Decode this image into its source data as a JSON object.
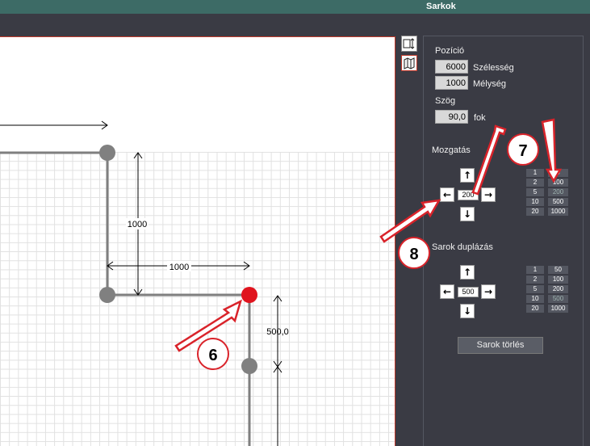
{
  "window": {
    "title": "Sarkok"
  },
  "canvas": {
    "dim_vertical": "1000",
    "dim_horizontal": "1000",
    "dim_side": "500,0"
  },
  "side_icons": [
    "resize-icon",
    "map-icon"
  ],
  "position": {
    "heading": "Pozíció",
    "width_value": "6000",
    "width_label": "Szélesség",
    "depth_value": "1000",
    "depth_label": "Mélység"
  },
  "angle": {
    "heading": "Szög",
    "value": "90,0",
    "unit": "fok"
  },
  "move": {
    "heading": "Mozgatás",
    "step_value": "200",
    "steps_left": [
      "1",
      "2",
      "5",
      "10",
      "20"
    ],
    "steps_right": [
      "0",
      "100",
      "200",
      "500",
      "1000"
    ],
    "selected_right": "200"
  },
  "duplicate": {
    "heading": "Sarok duplázás",
    "step_value": "500",
    "steps_left": [
      "1",
      "2",
      "5",
      "10",
      "20"
    ],
    "steps_right": [
      "50",
      "100",
      "200",
      "500",
      "1000"
    ],
    "selected_right": "500"
  },
  "delete_button": "Sarok törlés",
  "annotations": [
    "6",
    "7",
    "8"
  ],
  "colors": {
    "titlebar": "#3d6b66",
    "panel_bg": "#3a3b44",
    "selected_corner": "#e0141e",
    "corner": "#808080",
    "annotation_arrow": "#d9232a"
  }
}
